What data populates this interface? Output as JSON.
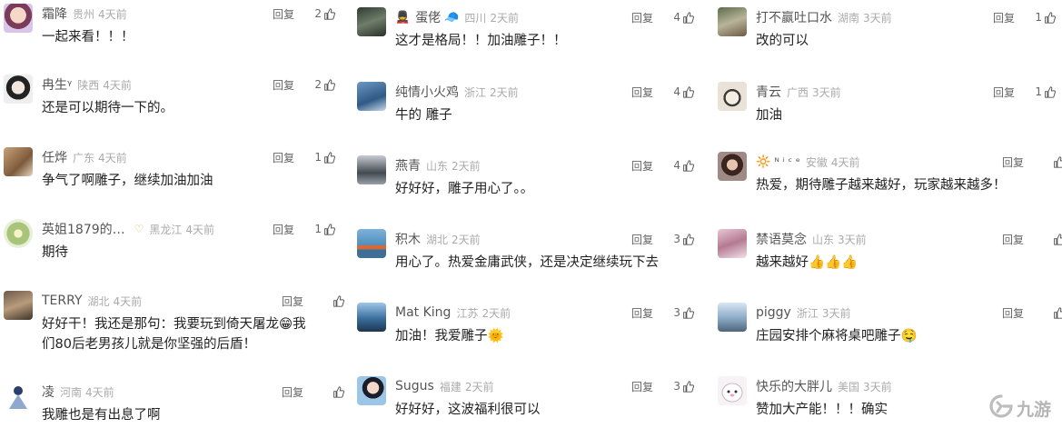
{
  "common": {
    "reply": "回复"
  },
  "columns": [
    {
      "comments": [
        {
          "user": "霜降",
          "loc": "贵州",
          "time": "4天前",
          "likes": "2",
          "text": "一起来看！！！"
        },
        {
          "user": "冉生ᵞ",
          "loc": "陕西",
          "time": "4天前",
          "likes": "2",
          "text": "还是可以期待一下的。"
        },
        {
          "user": "任烨",
          "loc": "广东",
          "time": "4天前",
          "likes": "1",
          "text": "争气了啊雕子，继续加油加油"
        },
        {
          "user": "英姐1879的…",
          "badge": "♡",
          "loc": "黑龙江",
          "time": "4天前",
          "likes": "1",
          "text": "期待"
        },
        {
          "user": "TERRY",
          "loc": "湖北",
          "time": "4天前",
          "likes": "",
          "text": "好好干！我还是那句：我要玩到倚天屠龙😁我",
          "text2": "们80后老男孩儿就是你坚强的后盾！"
        },
        {
          "user": "凌",
          "loc": "河南",
          "time": "4天前",
          "likes": "",
          "text": "我雕也是有出息了啊"
        }
      ]
    },
    {
      "comments": [
        {
          "user": "蛋佬",
          "prefix": "💂",
          "suffix": "🧢",
          "loc": "四川",
          "time": "2天前",
          "likes": "4",
          "text": "这才是格局！！加油雕子！！"
        },
        {
          "user": "纯情小火鸡",
          "loc": "浙江",
          "time": "2天前",
          "likes": "4",
          "text": "牛的 雕子"
        },
        {
          "user": "燕青",
          "loc": "山东",
          "time": "2天前",
          "likes": "4",
          "text": "好好好，雕子用心了。。"
        },
        {
          "user": "积木",
          "loc": "湖北",
          "time": "2天前",
          "likes": "3",
          "text": "用心了。热爱金庸武侠，还是决定继续玩下去"
        },
        {
          "user": "Mat King",
          "loc": "江苏",
          "time": "2天前",
          "likes": "3",
          "text": "加油！我爱雕子🌞"
        },
        {
          "user": "Sugus",
          "loc": "福建",
          "time": "2天前",
          "likes": "3",
          "text": "好好好，这波福利很可以"
        }
      ]
    },
    {
      "comments": [
        {
          "user": "打不赢吐口水",
          "loc": "湖南",
          "time": "3天前",
          "likes": "1",
          "text": "改的可以"
        },
        {
          "user": "青云",
          "loc": "广西",
          "time": "3天前",
          "likes": "1",
          "text": "加油"
        },
        {
          "user": "ᴺ ⁱ ᶜ ᵉ",
          "prefix": "🔆",
          "loc": "安徽",
          "time": "4天前",
          "likes": "",
          "text": "热爱，期待雕子越来越好，玩家越来越多！"
        },
        {
          "user": "禁语莫念",
          "loc": "山东",
          "time": "3天前",
          "likes": "",
          "text": "越来越好👍👍👍"
        },
        {
          "user": "piggy",
          "loc": "浙江",
          "time": "3天前",
          "likes": "",
          "text": "庄园安排个麻将桌吧雕子🤤"
        },
        {
          "user": "快乐的大胖儿",
          "loc": "美国",
          "time": "3天前",
          "likes": "",
          "text": "赞加大产能！！！确实"
        }
      ]
    }
  ],
  "watermark": {
    "text": "九游"
  },
  "colors": {
    "text": "#222222",
    "meta": "#aaaaaa",
    "username": "#555555"
  }
}
